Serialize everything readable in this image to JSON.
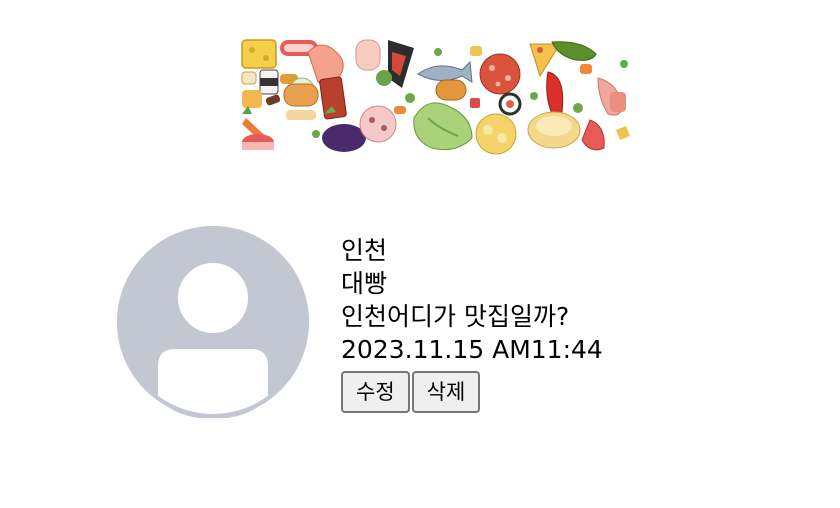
{
  "banner": {
    "logo_icon": "food-collage-logo-icon"
  },
  "profile": {
    "avatar_icon": "default-user-avatar-icon",
    "colors": {
      "avatar_fill": "#c2c7d1",
      "avatar_background": "#ffffff"
    }
  },
  "post": {
    "region": "인천",
    "author": "대빵",
    "content": "인천어디가 맛집일까?",
    "datetime": "2023.11.15 AM11:44"
  },
  "actions": {
    "edit_label": "수정",
    "delete_label": "삭제"
  }
}
